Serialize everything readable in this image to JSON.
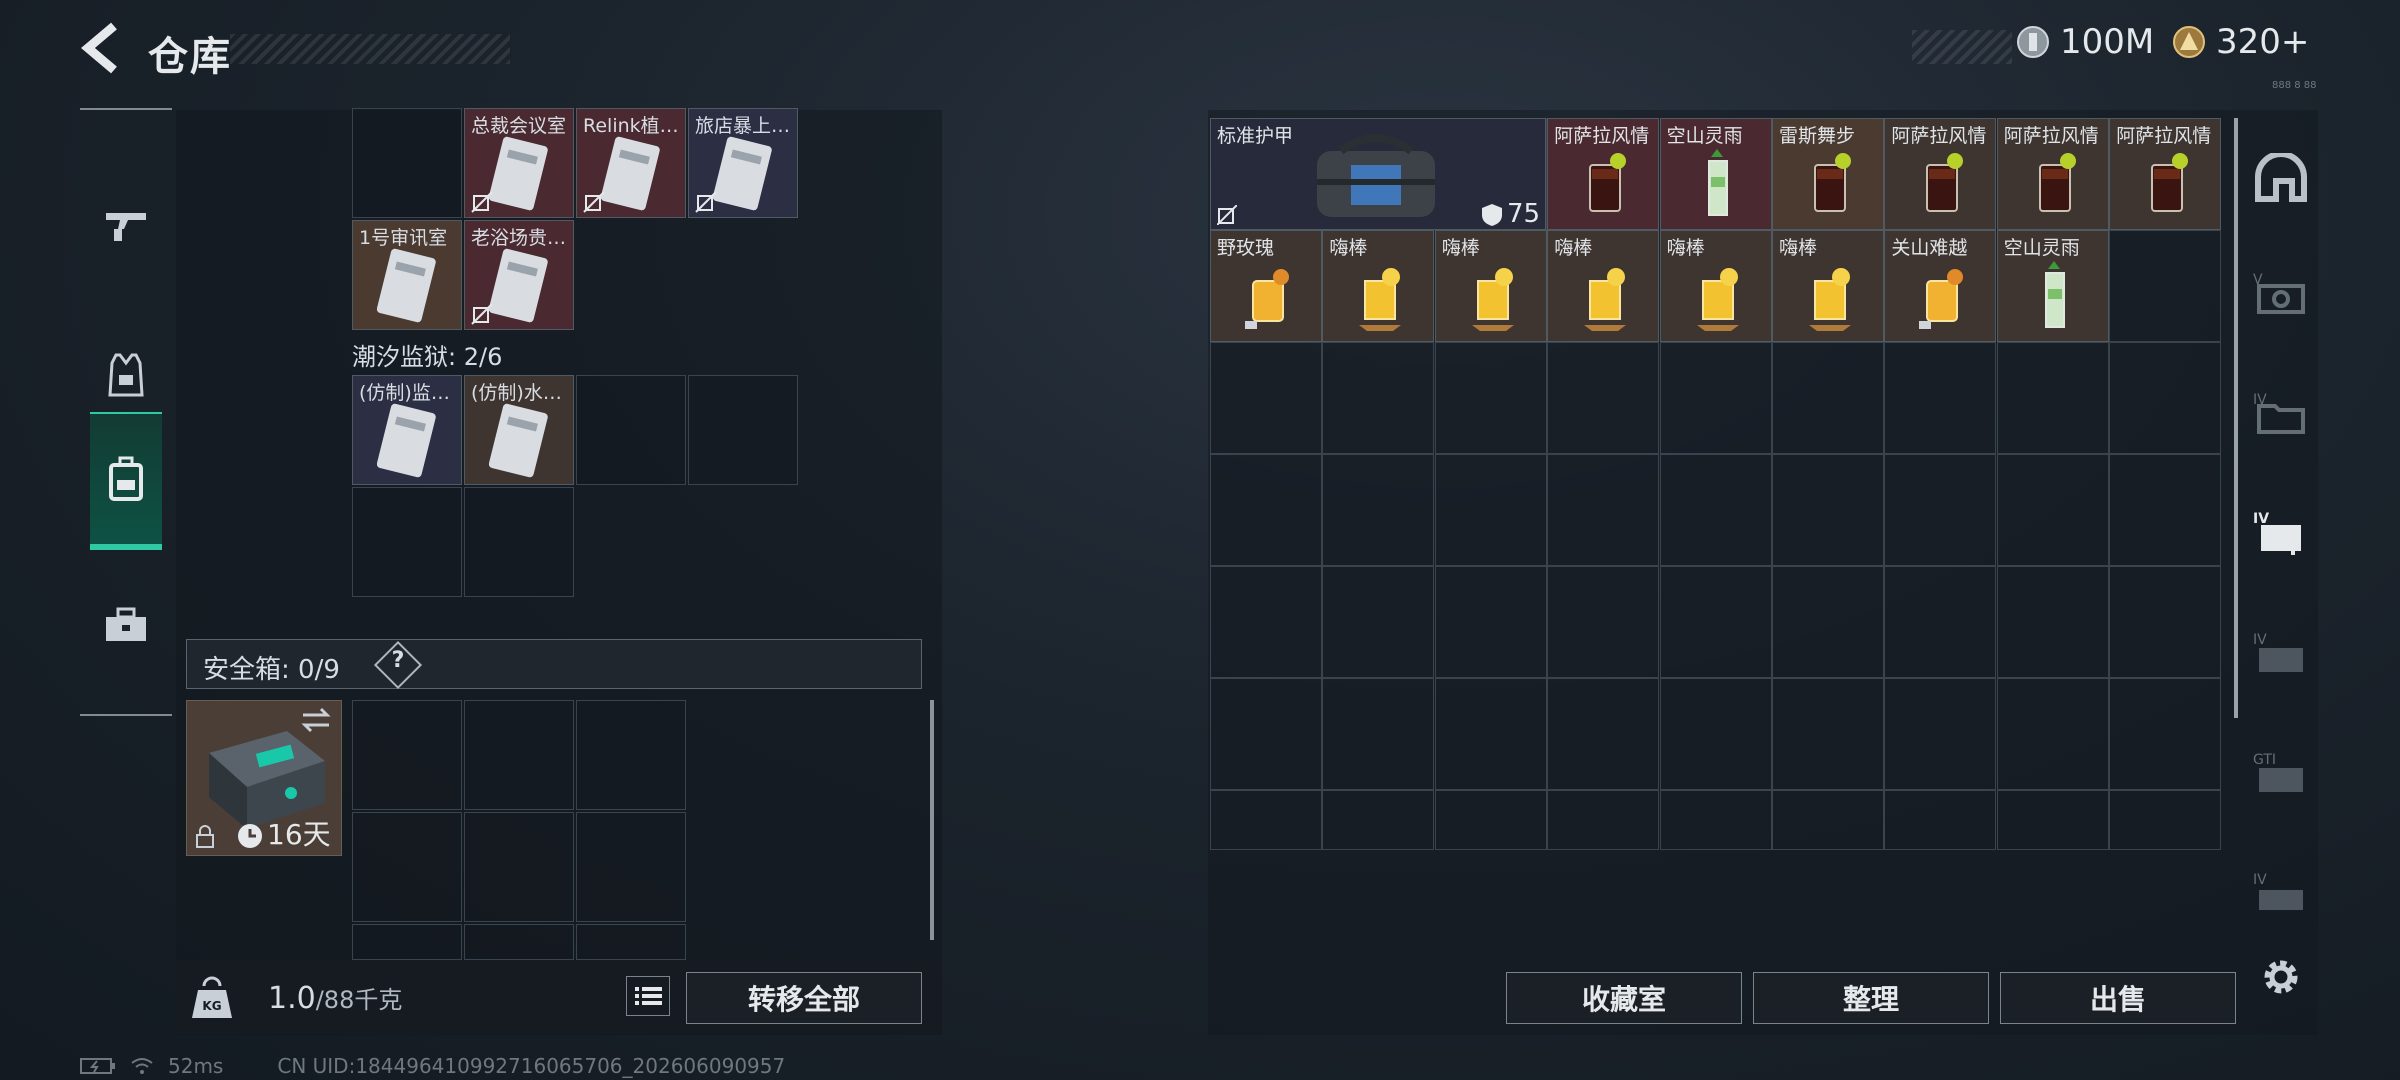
{
  "header": {
    "title": "仓库",
    "currency_silver": "100M",
    "currency_gold": "320+",
    "tiny_text": "888 8 88"
  },
  "left_nav": [
    {
      "name": "weapons-tab",
      "icon": "gun-icon"
    },
    {
      "name": "armor-tab",
      "icon": "vest-icon"
    },
    {
      "name": "backpack-tab",
      "icon": "backpack-icon",
      "active": true
    },
    {
      "name": "toolbox-tab",
      "icon": "toolbox-icon"
    }
  ],
  "keycards_top": [
    {
      "label": "总裁会议室",
      "bg": "#4a2a30"
    },
    {
      "label": "Relink植…",
      "bg": "#4a2a30"
    },
    {
      "label": "旅店暴上…",
      "bg": "#2c2e44"
    },
    {
      "label": "1号审讯室",
      "bg": "#4a3a30"
    },
    {
      "label": "老浴场贵…",
      "bg": "#4a2a30"
    }
  ],
  "prison": {
    "label": "潮汐监狱: 2/6",
    "cards": [
      {
        "label": "(仿制)监…",
        "bg": "#2c2e44"
      },
      {
        "label": "(仿制)水…",
        "bg": "#3e3530"
      }
    ]
  },
  "safe": {
    "label": "安全箱: 0/9",
    "help": "?",
    "days": "16天"
  },
  "bottom_left": {
    "weight_value": "1.0",
    "weight_cap": "/88千克",
    "transfer_all": "转移全部"
  },
  "right_items": {
    "armor": {
      "label": "标准护甲",
      "durability": "75"
    },
    "row1": [
      {
        "label": "阿萨拉风情",
        "bg": "#4a2a30",
        "drink": "cola"
      },
      {
        "label": "空山灵雨",
        "bg": "#4a2a30",
        "drink": "mojito"
      },
      {
        "label": "雷斯舞步",
        "bg": "#4a3a30",
        "drink": "cola"
      },
      {
        "label": "阿萨拉风情",
        "bg": "#3e3530",
        "drink": "cola"
      },
      {
        "label": "阿萨拉风情",
        "bg": "#3e3530",
        "drink": "cola"
      },
      {
        "label": "阿萨拉风情",
        "bg": "#3e3530",
        "drink": "cola"
      }
    ],
    "row2": [
      {
        "label": "野玫瑰",
        "bg": "#3e3530",
        "drink": "juice"
      },
      {
        "label": "嗨棒",
        "bg": "#3e3530",
        "drink": "lemon"
      },
      {
        "label": "嗨棒",
        "bg": "#3e3530",
        "drink": "lemon"
      },
      {
        "label": "嗨棒",
        "bg": "#3e3530",
        "drink": "lemon"
      },
      {
        "label": "嗨棒",
        "bg": "#3e3530",
        "drink": "lemon"
      },
      {
        "label": "嗨棒",
        "bg": "#3e3530",
        "drink": "lemon"
      },
      {
        "label": "关山难越",
        "bg": "#3e3530",
        "drink": "juice"
      },
      {
        "label": "空山灵雨",
        "bg": "#3e3530",
        "drink": "mojito"
      }
    ]
  },
  "bottom_right": {
    "collection": "收藏室",
    "sort": "整理",
    "sell": "出售"
  },
  "right_nav": [
    "home-icon",
    "camera-icon",
    "folder-icon",
    "medkit-icon",
    "tag-icon",
    "card-icon",
    "case-icon"
  ],
  "status_bar": {
    "ping": "52ms",
    "uid": "CN UID:18449641099271606570​6_202606090957"
  },
  "colors": {
    "accent": "#2fc9a3",
    "panel": "#151b21"
  }
}
